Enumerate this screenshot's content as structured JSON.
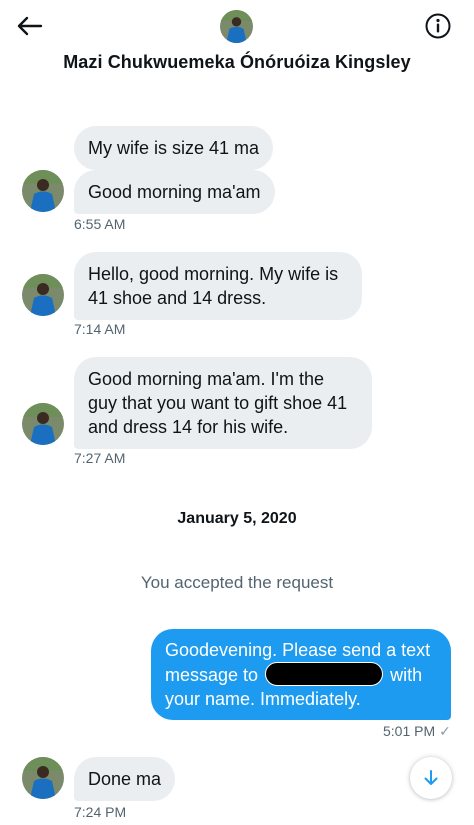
{
  "header": {
    "title": "Mazi Chukwuemeka Ónóruóiza Kingsley",
    "back_icon": "arrow-left-icon",
    "info_icon": "info-icon"
  },
  "colors": {
    "bubble_in": "#ebeef0",
    "bubble_out": "#1d9bf0",
    "muted_text": "#536471",
    "avatar_blue": "#1b6fc0"
  },
  "messages": [
    {
      "text": "My wife is size 41 ma"
    },
    {
      "text": "Good morning ma'am",
      "time": "6:55 AM"
    },
    {
      "line1": "Hello, good morning. My wife is",
      "line2": "41 shoe and 14 dress.",
      "time": "7:14 AM"
    },
    {
      "line1": "Good morning ma'am. I'm the",
      "line2": "guy that you want to gift shoe 41",
      "line3": "and dress 14 for his wife.",
      "time": "7:27 AM"
    }
  ],
  "date_divider": "January 5, 2020",
  "system_note": "You accepted the request",
  "outgoing": {
    "line1": "Goodevening. Please send a text",
    "line2_pre": "message to",
    "line2_post": "with",
    "line3": "your name. Immediately.",
    "time": "5:01 PM",
    "status_glyph": "✓"
  },
  "last_message": {
    "text": "Done ma",
    "time": "7:24 PM"
  },
  "scroll_icon": "arrow-down-icon"
}
